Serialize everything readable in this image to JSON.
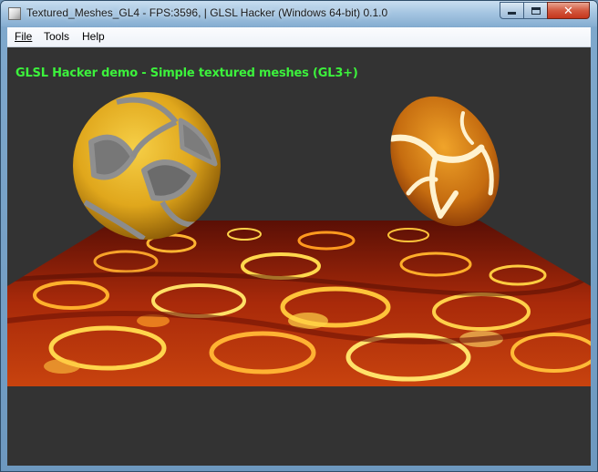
{
  "window": {
    "title": "Textured_Meshes_GL4 - FPS:3596,  | GLSL Hacker (Windows 64-bit) 0.1.0",
    "icon": "app-icon",
    "controls": {
      "minimize_icon": "minimize-icon",
      "maximize_icon": "maximize-icon",
      "close_icon": "close-icon",
      "close_glyph": "✕"
    }
  },
  "menu": {
    "items": [
      {
        "label": "File",
        "accelerator": "F"
      },
      {
        "label": "Tools"
      },
      {
        "label": "Help"
      }
    ]
  },
  "viewport": {
    "background": "#333333",
    "overlay_text": "GLSL Hacker demo - Simple textured meshes (GL3+)",
    "overlay_color": "#3cf23c",
    "objects": [
      "textured-sphere",
      "textured-ellipsoid",
      "textured-floor-plane"
    ]
  },
  "colors": {
    "titlebar": "#a6c6e2",
    "close_button": "#c5351c",
    "sphere_texture": "#e8b020",
    "ellipsoid_texture": "#d9961c",
    "floor_texture": "#b42008"
  }
}
